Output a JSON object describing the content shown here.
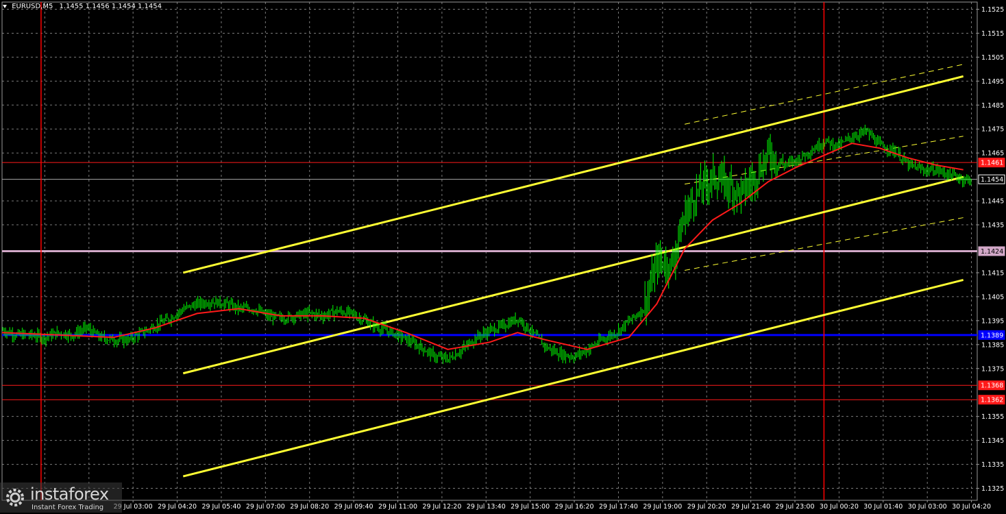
{
  "header": {
    "symbol": "EURUSD,M5",
    "ohlc": "1.1455 1.1456 1.1454 1.1454"
  },
  "logo": {
    "brand": "instaforex",
    "tagline": "Instant Forex Trading"
  },
  "colors": {
    "background": "#000000",
    "grid": "#9a9a9a",
    "candles": "#00ff00",
    "ma": "#ff1a1a",
    "channel": "#ffff33",
    "ichimoku_line": "#0000ff",
    "level_line": "#d2a8c8",
    "support_line": "#ff1a1a",
    "session_line": "#ff0000"
  },
  "chart_data": {
    "type": "candlestick",
    "title": "",
    "ylim": [
      1.132,
      1.1528
    ],
    "x_tick_labels": [
      "29 Jul 03:00",
      "29 Jul 04:20",
      "29 Jul 05:40",
      "29 Jul 07:00",
      "29 Jul 08:20",
      "29 Jul 09:40",
      "29 Jul 11:00",
      "29 Jul 12:20",
      "29 Jul 13:40",
      "29 Jul 15:00",
      "29 Jul 16:20",
      "29 Jul 17:40",
      "29 Jul 19:00",
      "29 Jul 20:20",
      "29 Jul 21:40",
      "29 Jul 23:00",
      "30 Jul 00:20",
      "30 Jul 01:40",
      "30 Jul 03:00",
      "30 Jul 04:20"
    ],
    "y_tick_labels": [
      "1.1525",
      "1.1515",
      "1.1505",
      "1.1495",
      "1.1485",
      "1.1475",
      "1.1465",
      "1.1445",
      "1.1435",
      "1.1415",
      "1.1405",
      "1.1395",
      "1.1385",
      "1.1375",
      "1.1355",
      "1.1345",
      "1.1335",
      "1.1325"
    ],
    "price_tags": [
      {
        "label": "1.1461",
        "value": 1.1461,
        "role": "level",
        "color": "#ff1a1a"
      },
      {
        "label": "1.1454",
        "value": 1.1454,
        "role": "current",
        "color": "#ffffff"
      },
      {
        "label": "1.1424",
        "value": 1.1424,
        "role": "level",
        "color": "#d2a8c8"
      },
      {
        "label": "1.1389",
        "value": 1.1389,
        "role": "kijun",
        "color": "#0000ff"
      },
      {
        "label": "1.1368",
        "value": 1.1368,
        "role": "level",
        "color": "#ff1a1a"
      },
      {
        "label": "1.1362",
        "value": 1.1362,
        "role": "level",
        "color": "#ff1a1a"
      }
    ],
    "price_path": [
      [
        0,
        1.1391
      ],
      [
        10,
        1.1389
      ],
      [
        20,
        1.1389
      ],
      [
        30,
        1.1388
      ],
      [
        40,
        1.139
      ],
      [
        50,
        1.1389
      ],
      [
        60,
        1.1392
      ],
      [
        70,
        1.1388
      ],
      [
        80,
        1.1387
      ],
      [
        90,
        1.1387
      ],
      [
        100,
        1.139
      ],
      [
        110,
        1.1393
      ],
      [
        120,
        1.1396
      ],
      [
        130,
        1.14
      ],
      [
        140,
        1.1402
      ],
      [
        150,
        1.1403
      ],
      [
        160,
        1.1402
      ],
      [
        170,
        1.14
      ],
      [
        180,
        1.14
      ],
      [
        190,
        1.1397
      ],
      [
        200,
        1.1396
      ],
      [
        210,
        1.1397
      ],
      [
        220,
        1.1398
      ],
      [
        230,
        1.1397
      ],
      [
        240,
        1.1399
      ],
      [
        250,
        1.1398
      ],
      [
        260,
        1.1395
      ],
      [
        270,
        1.1392
      ],
      [
        280,
        1.139
      ],
      [
        290,
        1.1387
      ],
      [
        300,
        1.1384
      ],
      [
        310,
        1.138
      ],
      [
        320,
        1.1379
      ],
      [
        330,
        1.1383
      ],
      [
        340,
        1.1388
      ],
      [
        350,
        1.1391
      ],
      [
        360,
        1.1393
      ],
      [
        370,
        1.1396
      ],
      [
        380,
        1.139
      ],
      [
        390,
        1.1384
      ],
      [
        400,
        1.1381
      ],
      [
        410,
        1.138
      ],
      [
        420,
        1.1383
      ],
      [
        430,
        1.1387
      ],
      [
        440,
        1.139
      ],
      [
        450,
        1.1395
      ],
      [
        460,
        1.14
      ],
      [
        470,
        1.142
      ],
      [
        480,
        1.1418
      ],
      [
        490,
        1.144
      ],
      [
        500,
        1.145
      ],
      [
        510,
        1.1455
      ],
      [
        520,
        1.1452
      ],
      [
        530,
        1.1448
      ],
      [
        540,
        1.1455
      ],
      [
        550,
        1.1465
      ],
      [
        560,
        1.146
      ],
      [
        570,
        1.1462
      ],
      [
        580,
        1.1466
      ],
      [
        590,
        1.147
      ],
      [
        600,
        1.1468
      ],
      [
        610,
        1.1472
      ],
      [
        620,
        1.1474
      ],
      [
        630,
        1.1468
      ],
      [
        640,
        1.1466
      ],
      [
        650,
        1.146
      ],
      [
        660,
        1.1458
      ],
      [
        670,
        1.1458
      ],
      [
        680,
        1.1456
      ],
      [
        690,
        1.1454
      ]
    ],
    "ma_path": [
      [
        0,
        1.139
      ],
      [
        40,
        1.1389
      ],
      [
        80,
        1.1388
      ],
      [
        110,
        1.1392
      ],
      [
        140,
        1.1398
      ],
      [
        170,
        1.14
      ],
      [
        200,
        1.1397
      ],
      [
        230,
        1.1397
      ],
      [
        260,
        1.1396
      ],
      [
        290,
        1.139
      ],
      [
        320,
        1.1383
      ],
      [
        350,
        1.1386
      ],
      [
        370,
        1.139
      ],
      [
        390,
        1.1387
      ],
      [
        420,
        1.1383
      ],
      [
        450,
        1.1388
      ],
      [
        470,
        1.1402
      ],
      [
        490,
        1.1425
      ],
      [
        510,
        1.1437
      ],
      [
        530,
        1.1444
      ],
      [
        550,
        1.1453
      ],
      [
        570,
        1.1459
      ],
      [
        590,
        1.1464
      ],
      [
        610,
        1.1469
      ],
      [
        630,
        1.1467
      ],
      [
        650,
        1.1463
      ],
      [
        670,
        1.146
      ],
      [
        690,
        1.1458
      ]
    ],
    "channel_lines": [
      {
        "style": "solid",
        "from": [
          130,
          1.1415
        ],
        "to": [
          690,
          1.1497
        ]
      },
      {
        "style": "solid",
        "from": [
          130,
          1.1373
        ],
        "to": [
          690,
          1.1455
        ]
      },
      {
        "style": "solid",
        "from": [
          130,
          1.133
        ],
        "to": [
          690,
          1.1412
        ]
      },
      {
        "style": "dashed",
        "from": [
          490,
          1.1477
        ],
        "to": [
          690,
          1.1502
        ]
      },
      {
        "style": "dashed",
        "from": [
          490,
          1.1452
        ],
        "to": [
          690,
          1.1472
        ]
      },
      {
        "style": "dashed",
        "from": [
          490,
          1.1416
        ],
        "to": [
          690,
          1.1438
        ]
      }
    ],
    "horizontal_lines": [
      {
        "value": 1.1461,
        "color": "#ff1a1a",
        "width": 1
      },
      {
        "value": 1.1454,
        "color": "#aaaaaa",
        "width": 1
      },
      {
        "value": 1.1424,
        "color": "#d2a8c8",
        "width": 3
      },
      {
        "value": 1.1389,
        "color": "#0000ff",
        "width": 3
      },
      {
        "value": 1.1368,
        "color": "#ff1a1a",
        "width": 1
      },
      {
        "value": 1.1362,
        "color": "#ff1a1a",
        "width": 1
      }
    ],
    "session_lines": [
      {
        "bar": 28
      },
      {
        "bar": 590
      }
    ]
  }
}
